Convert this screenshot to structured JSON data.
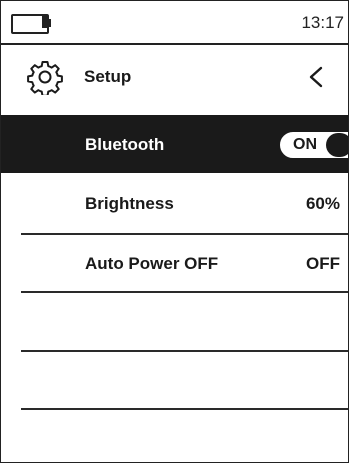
{
  "status_bar": {
    "battery_icon": "battery-icon",
    "time": "13:17"
  },
  "header": {
    "icon": "gear-icon",
    "title": "Setup",
    "back_icon": "chevron-left-icon"
  },
  "settings": [
    {
      "label": "Bluetooth",
      "control": "toggle",
      "value": "ON",
      "selected": true
    },
    {
      "label": "Brightness",
      "control": "value",
      "value": "60%",
      "selected": false
    },
    {
      "label": "Auto Power OFF",
      "control": "value",
      "value": "OFF",
      "selected": false
    }
  ],
  "colors": {
    "selected_background": "#1a1a1a",
    "selected_text": "#ffffff",
    "text": "#1a1a1a"
  }
}
